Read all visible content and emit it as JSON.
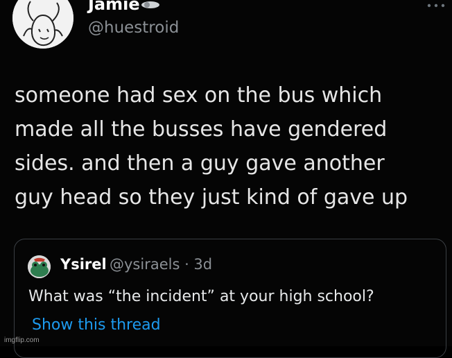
{
  "author": {
    "display_name": "Jamie",
    "handle": "@huestroid",
    "avatar_icon": "drawn-character-avatar-icon",
    "badge_icon": "pin-badge-icon"
  },
  "tweet": {
    "text": "someone had sex on the bus which\nmade all the busses have gendered\nsides. and then a guy gave another\nguy head so they just kind of gave up"
  },
  "more_icon": "more-options-icon",
  "quoted_tweet": {
    "display_name": "Ysirel",
    "handle_time": "@ysiraels · 3d",
    "text": "What was “the incident” at your high school?",
    "link_label": "Show this thread",
    "avatar_icon": "frog-avatar-icon"
  },
  "watermark": "imgflip.com",
  "colors": {
    "background": "#050505",
    "text": "#e7e9ea",
    "muted": "#8b9095",
    "link": "#1d9bf0",
    "border": "#3b3f44"
  }
}
